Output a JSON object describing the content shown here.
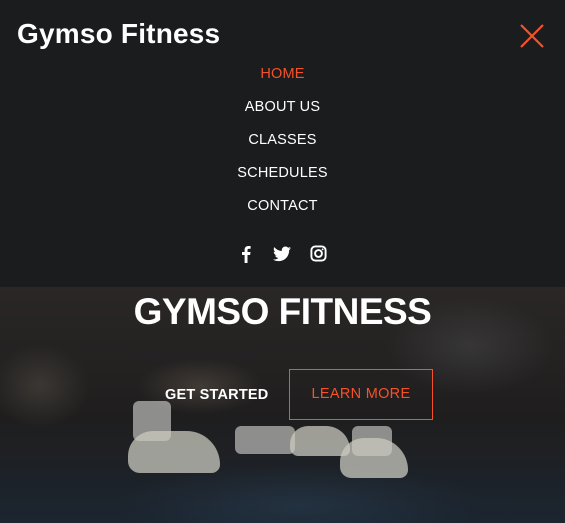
{
  "header": {
    "brand": "Gymso Fitness"
  },
  "menu": {
    "items": [
      {
        "label": "HOME",
        "active": true
      },
      {
        "label": "ABOUT US",
        "active": false
      },
      {
        "label": "CLASSES",
        "active": false
      },
      {
        "label": "SCHEDULES",
        "active": false
      },
      {
        "label": "CONTACT",
        "active": false
      }
    ]
  },
  "social": {
    "icons": [
      "facebook-icon",
      "twitter-icon",
      "instagram-icon"
    ]
  },
  "hero": {
    "title": "GYMSO FITNESS",
    "primary_label": "GET STARTED",
    "secondary_label": "LEARN MORE"
  },
  "colors": {
    "accent": "#f65129",
    "background": "#1b1c1e",
    "text": "#ffffff"
  }
}
